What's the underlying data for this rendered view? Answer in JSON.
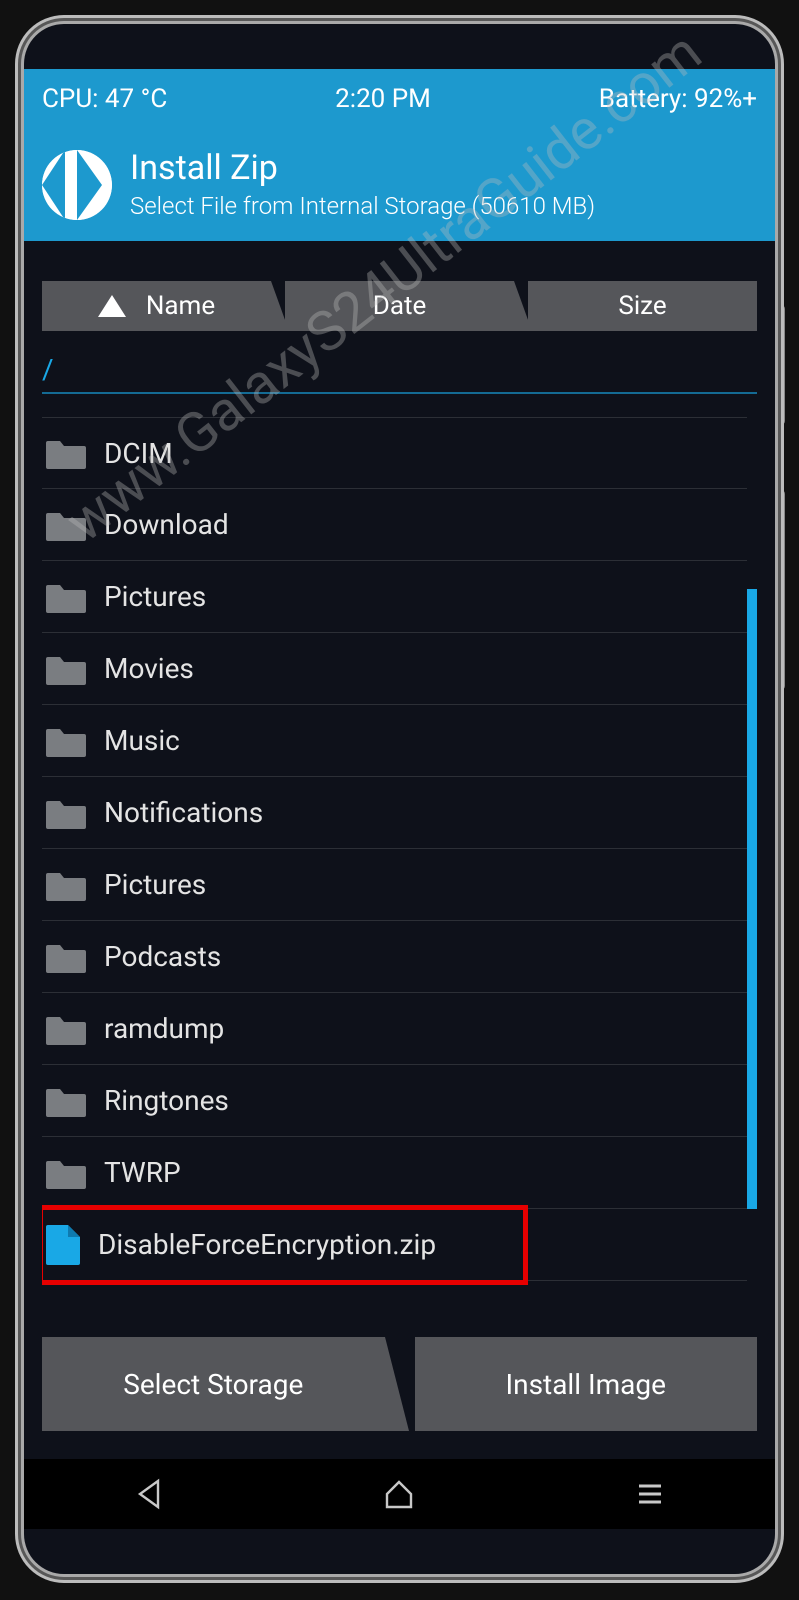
{
  "statusbar": {
    "cpu": "CPU: 47 °C",
    "time": "2:20 PM",
    "battery": "Battery: 92%+"
  },
  "titlebar": {
    "title": "Install Zip",
    "subtitle": "Select File from Internal Storage (50610 MB)"
  },
  "sort": {
    "name": "Name",
    "date": "Date",
    "size": "Size"
  },
  "path": "/",
  "files": {
    "f0": "DCIM",
    "f1": "Download",
    "f2": "Pictures",
    "f3": "Movies",
    "f4": "Music",
    "f5": "Notifications",
    "f6": "Pictures",
    "f7": "Podcasts",
    "f8": "ramdump",
    "f9": "Ringtones",
    "f10": "TWRP",
    "zip": "DisableForceEncryption.zip"
  },
  "buttons": {
    "storage": "Select Storage",
    "image": "Install Image"
  },
  "watermark": "www.GalaxyS24UltraGuide.com"
}
